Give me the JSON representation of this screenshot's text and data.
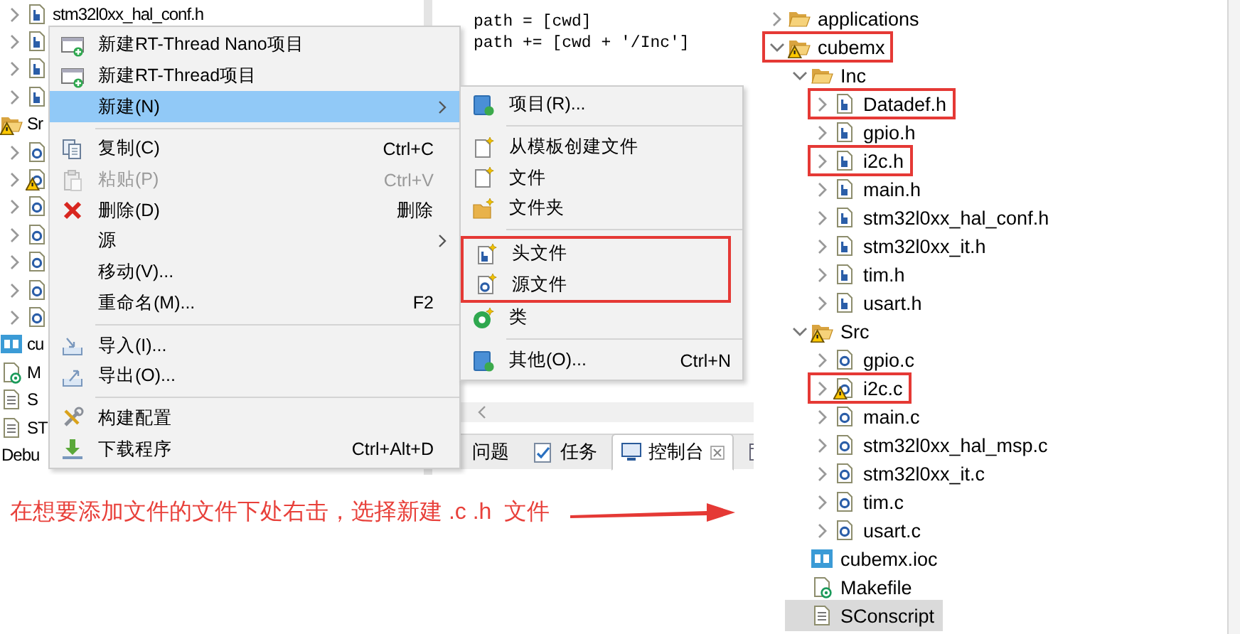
{
  "left_screenshot": {
    "project_tree": {
      "leading_children": [
        {
          "kind": "h",
          "label": "stm32l0xx_hal_conf.h",
          "expanded": false,
          "warning": false
        },
        {
          "kind": "h",
          "expanded": false,
          "warning": false
        },
        {
          "kind": "h",
          "expanded": false,
          "warning": false
        },
        {
          "kind": "h",
          "expanded": false,
          "warning": false
        }
      ],
      "items": [
        {
          "kind": "folder",
          "label": "Sr",
          "warning": true,
          "children": [
            {
              "kind": "c",
              "expanded": false,
              "warning": false
            },
            {
              "kind": "c",
              "expanded": false,
              "warning": true
            },
            {
              "kind": "c",
              "expanded": false,
              "warning": false
            },
            {
              "kind": "c",
              "expanded": false,
              "warning": false
            },
            {
              "kind": "c",
              "expanded": false,
              "warning": false
            },
            {
              "kind": "c",
              "expanded": false,
              "warning": false
            },
            {
              "kind": "c",
              "expanded": false,
              "warning": false
            }
          ]
        },
        {
          "kind": "mx",
          "label": "cu",
          "warning": false
        },
        {
          "kind": "make",
          "label": "M",
          "warning": false
        },
        {
          "kind": "doc",
          "label": "S",
          "warning": false
        },
        {
          "kind": "doc",
          "label": "ST",
          "warning": false
        },
        {
          "kind": "plain",
          "label": "Debu"
        }
      ]
    },
    "editor": {
      "lines": [
        "path = [cwd]",
        "path += [cwd + '/Inc']"
      ]
    },
    "bottom_tabs": [
      {
        "kind": "problems",
        "label": "问题",
        "selected": false,
        "closable": false
      },
      {
        "kind": "tasks",
        "label": "任务",
        "selected": false,
        "closable": false
      },
      {
        "kind": "console",
        "label": "控制台",
        "selected": true,
        "closable": true
      },
      {
        "kind": "properties",
        "selected": false
      }
    ],
    "context_menu": {
      "groups": [
        [
          {
            "kind": "new-project",
            "label": "新建RT-Thread Nano项目",
            "selected": false,
            "disabled": false,
            "submenu": false
          },
          {
            "kind": "new-project",
            "label": "新建RT-Thread项目",
            "selected": false,
            "disabled": false,
            "submenu": false
          },
          {
            "kind": "plain",
            "label": "新建(N)",
            "selected": true,
            "disabled": false,
            "submenu": true
          }
        ],
        [
          {
            "kind": "copy",
            "label": "复制(C)",
            "shortcut": "Ctrl+C",
            "selected": false,
            "disabled": false,
            "submenu": false
          },
          {
            "kind": "paste",
            "label": "粘贴(P)",
            "shortcut": "Ctrl+V",
            "selected": false,
            "disabled": true,
            "submenu": false
          },
          {
            "kind": "delete",
            "label": "删除(D)",
            "shortcut": "删除",
            "selected": false,
            "disabled": false,
            "submenu": false
          },
          {
            "kind": "plain",
            "label": "源",
            "selected": false,
            "disabled": false,
            "submenu": true
          },
          {
            "kind": "plain",
            "label": "移动(V)...",
            "selected": false,
            "disabled": false,
            "submenu": false
          },
          {
            "kind": "plain",
            "label": "重命名(M)...",
            "shortcut": "F2",
            "selected": false,
            "disabled": false,
            "submenu": false
          }
        ],
        [
          {
            "kind": "import",
            "label": "导入(I)...",
            "selected": false,
            "disabled": false,
            "submenu": false
          },
          {
            "kind": "export",
            "label": "导出(O)...",
            "selected": false,
            "disabled": false,
            "submenu": false
          }
        ],
        [
          {
            "kind": "build",
            "label": "构建配置",
            "selected": false,
            "disabled": false,
            "submenu": false
          },
          {
            "kind": "download",
            "label": "下载程序",
            "shortcut": "Ctrl+Alt+D",
            "selected": false,
            "disabled": false,
            "submenu": false
          }
        ]
      ]
    },
    "new_submenu": {
      "groups": [
        [
          {
            "kind": "project",
            "label": "项目(R)...",
            "selected": false,
            "highlighted": false
          }
        ],
        [
          {
            "kind": "new-file",
            "label": "从模板创建文件",
            "selected": false,
            "highlighted": false
          },
          {
            "kind": "new-file",
            "label": "文件",
            "selected": false,
            "highlighted": false
          },
          {
            "kind": "new-folder",
            "label": "文件夹",
            "selected": false,
            "highlighted": false
          }
        ],
        [
          {
            "kind": "new-header",
            "label": "头文件",
            "selected": false,
            "highlighted": true
          },
          {
            "kind": "new-source",
            "label": "源文件",
            "selected": false,
            "highlighted": true
          },
          {
            "kind": "class",
            "label": "类",
            "selected": false,
            "highlighted": false
          }
        ],
        [
          {
            "kind": "project",
            "label": "其他(O)...",
            "shortcut": "Ctrl+N",
            "selected": false,
            "highlighted": false
          }
        ]
      ]
    }
  },
  "annotation": {
    "text": "在想要添加文件的文件下处右击，选择新建 .c .h  文件"
  },
  "right_screenshot": {
    "project_tree": [
      {
        "kind": "folder",
        "label": "applications",
        "expanded": false,
        "warning": false,
        "selected": false,
        "highlighted": false
      },
      {
        "kind": "folder",
        "label": "cubemx",
        "expanded": true,
        "warning": true,
        "selected": false,
        "highlighted": true,
        "children": [
          {
            "kind": "folder",
            "label": "Inc",
            "expanded": true,
            "warning": false,
            "selected": false,
            "highlighted": false,
            "children": [
              {
                "kind": "h",
                "label": "Datadef.h",
                "expanded": false,
                "warning": false,
                "selected": false,
                "highlighted": true
              },
              {
                "kind": "h",
                "label": "gpio.h",
                "expanded": false,
                "warning": false,
                "selected": false,
                "highlighted": false
              },
              {
                "kind": "h",
                "label": "i2c.h",
                "expanded": false,
                "warning": false,
                "selected": false,
                "highlighted": true
              },
              {
                "kind": "h",
                "label": "main.h",
                "expanded": false,
                "warning": false,
                "selected": false,
                "highlighted": false
              },
              {
                "kind": "h",
                "label": "stm32l0xx_hal_conf.h",
                "expanded": false,
                "warning": false,
                "selected": false,
                "highlighted": false
              },
              {
                "kind": "h",
                "label": "stm32l0xx_it.h",
                "expanded": false,
                "warning": false,
                "selected": false,
                "highlighted": false
              },
              {
                "kind": "h",
                "label": "tim.h",
                "expanded": false,
                "warning": false,
                "selected": false,
                "highlighted": false
              },
              {
                "kind": "h",
                "label": "usart.h",
                "expanded": false,
                "warning": false,
                "selected": false,
                "highlighted": false
              }
            ]
          },
          {
            "kind": "folder",
            "label": "Src",
            "expanded": true,
            "warning": true,
            "selected": false,
            "highlighted": false,
            "children": [
              {
                "kind": "c",
                "label": "gpio.c",
                "expanded": false,
                "warning": false,
                "selected": false,
                "highlighted": false
              },
              {
                "kind": "c",
                "label": "i2c.c",
                "expanded": false,
                "warning": true,
                "selected": false,
                "highlighted": true
              },
              {
                "kind": "c",
                "label": "main.c",
                "expanded": false,
                "warning": false,
                "selected": false,
                "highlighted": false
              },
              {
                "kind": "c",
                "label": "stm32l0xx_hal_msp.c",
                "expanded": false,
                "warning": false,
                "selected": false,
                "highlighted": false
              },
              {
                "kind": "c",
                "label": "stm32l0xx_it.c",
                "expanded": false,
                "warning": false,
                "selected": false,
                "highlighted": false
              },
              {
                "kind": "c",
                "label": "tim.c",
                "expanded": false,
                "warning": false,
                "selected": false,
                "highlighted": false
              },
              {
                "kind": "c",
                "label": "usart.c",
                "expanded": false,
                "warning": false,
                "selected": false,
                "highlighted": false
              }
            ]
          },
          {
            "kind": "mx",
            "label": "cubemx.ioc",
            "warning": false,
            "selected": false,
            "highlighted": false
          },
          {
            "kind": "make",
            "label": "Makefile",
            "warning": false,
            "selected": false,
            "highlighted": false
          },
          {
            "kind": "doc",
            "label": "SConscript",
            "warning": false,
            "selected": true,
            "highlighted": false
          }
        ]
      }
    ]
  }
}
